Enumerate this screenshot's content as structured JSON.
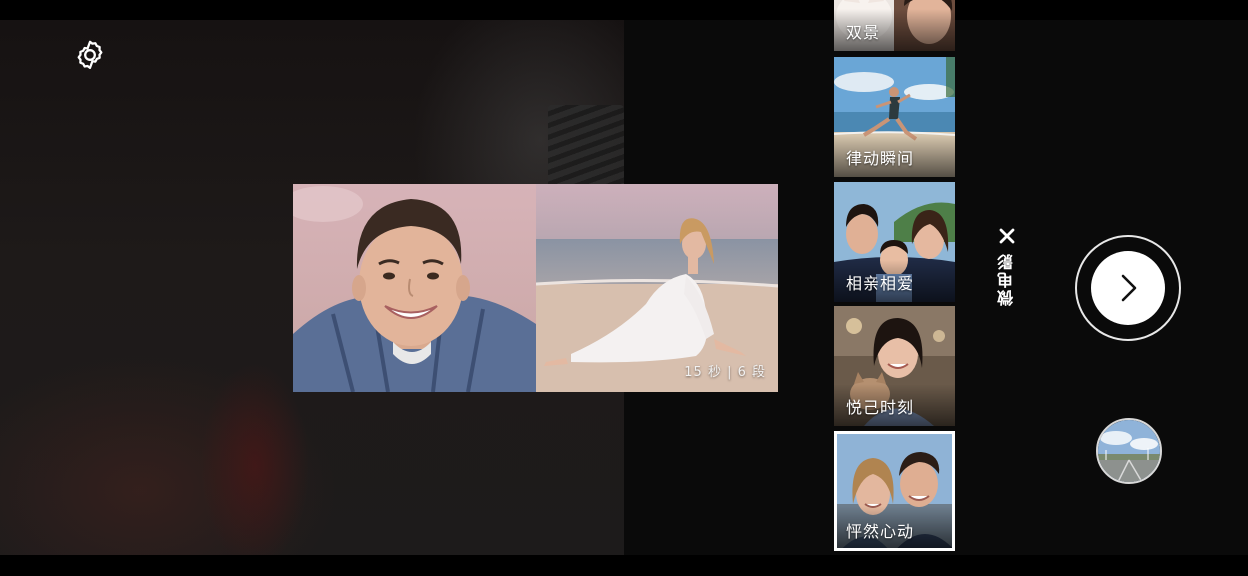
{
  "top_bar": {
    "settings_icon": "gear-icon"
  },
  "preview": {
    "badge": "15 秒 | 6 段"
  },
  "templates": [
    {
      "label": "双景",
      "selected": false
    },
    {
      "label": "律动瞬间",
      "selected": false
    },
    {
      "label": "相亲相爱",
      "selected": false
    },
    {
      "label": "悦己时刻",
      "selected": false
    },
    {
      "label": "怦然心动",
      "selected": true
    }
  ],
  "mode": {
    "label": "微电影",
    "close_icon": "close-icon"
  },
  "shutter": {
    "icon": "chevron-right-icon"
  },
  "gallery": {
    "icon": "gallery-thumbnail"
  },
  "colors": {
    "background": "#000000",
    "accent": "#ffffff"
  }
}
